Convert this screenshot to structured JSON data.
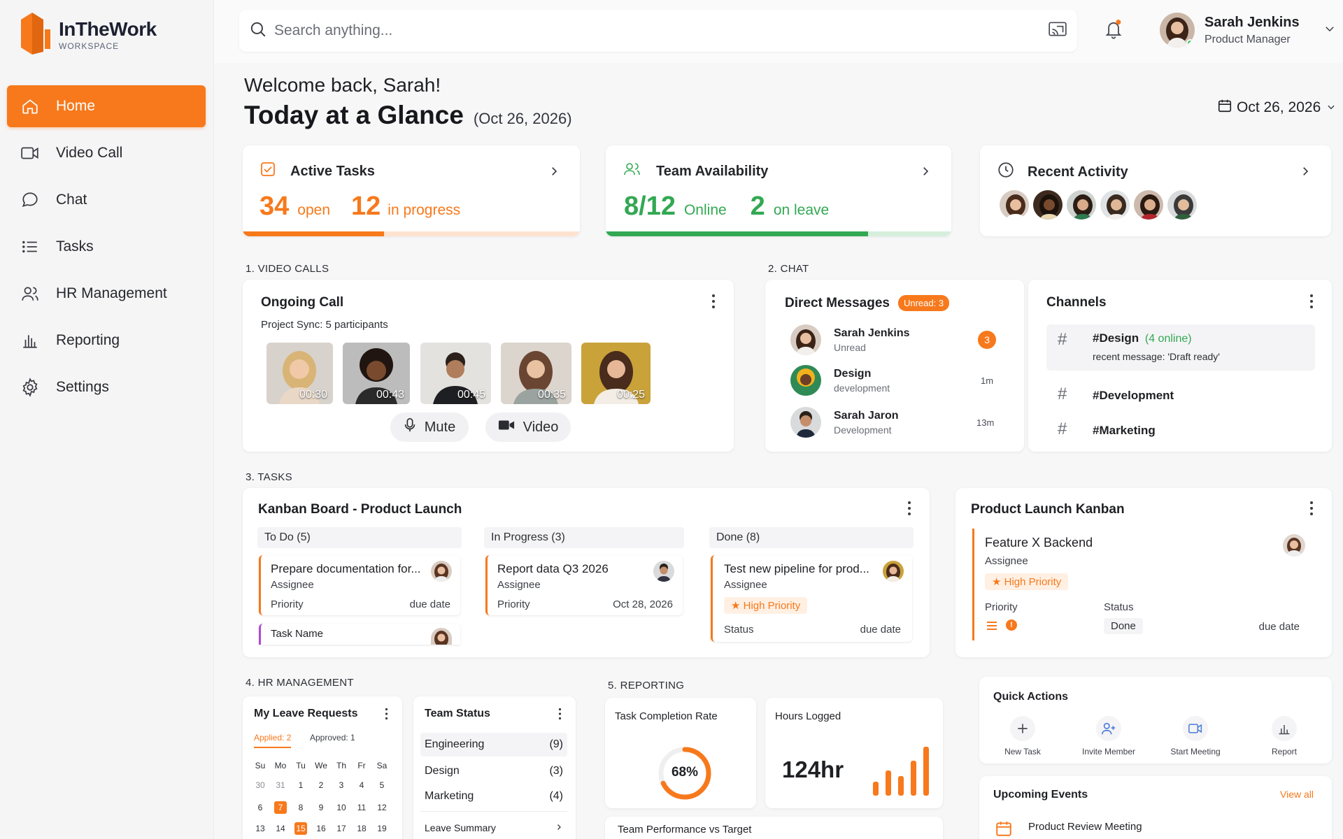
{
  "app": {
    "name": "InTheWork",
    "subtitle": "WORKSPACE"
  },
  "colors": {
    "accent": "#f7791c",
    "green": "#33a853",
    "text": "#1f2024"
  },
  "sidebar": {
    "items": [
      {
        "label": "Home",
        "icon": "home-icon",
        "active": true
      },
      {
        "label": "Video Call",
        "icon": "video-icon"
      },
      {
        "label": "Chat",
        "icon": "chat-icon"
      },
      {
        "label": "Tasks",
        "icon": "list-icon"
      },
      {
        "label": "HR Management",
        "icon": "people-icon"
      },
      {
        "label": "Reporting",
        "icon": "bar-chart-icon"
      },
      {
        "label": "Settings",
        "icon": "gear-icon"
      }
    ]
  },
  "topbar": {
    "search_placeholder": "Search anything...",
    "user_name": "Sarah Jenkins",
    "user_role": "Product Manager"
  },
  "header": {
    "greeting": "Welcome back, Sarah!",
    "title": "Today at a Glance",
    "title_date": "(Oct 26, 2026)",
    "date_picker": "Oct 26, 2026"
  },
  "kpi": {
    "tasks": {
      "title": "Active Tasks",
      "open": "34",
      "open_label": "open",
      "progress": "12",
      "progress_label": "in progress",
      "fill": 0.42
    },
    "team": {
      "title": "Team Availability",
      "online": "8/12",
      "online_label": "Online",
      "leave": "2",
      "leave_label": "on leave",
      "fill": 0.76
    },
    "activity": {
      "title": "Recent Activity"
    }
  },
  "video": {
    "section": "1. VIDEO CALLS",
    "title": "Ongoing Call",
    "subtitle": "Project Sync: 5 participants",
    "times": [
      "00:30",
      "00:43",
      "00:45",
      "00:35",
      "00:25"
    ],
    "mute": "Mute",
    "video": "Video"
  },
  "chat": {
    "section": "2. CHAT",
    "dm_title": "Direct Messages",
    "unread_badge": "Unread: 3",
    "dms": [
      {
        "name": "Sarah Jenkins",
        "sub": "Unread",
        "meta": "3"
      },
      {
        "name": "Design",
        "sub": "development",
        "meta": "1m"
      },
      {
        "name": "Sarah Jaron",
        "sub": "Development",
        "meta": "13m"
      }
    ],
    "channels_title": "Channels",
    "channels": [
      {
        "name": "#Design",
        "extra": "(4 online)",
        "msg": "recent message: 'Draft ready'"
      },
      {
        "name": "#Development"
      },
      {
        "name": "#Marketing"
      }
    ]
  },
  "tasks": {
    "section": "3. TASKS",
    "board_title": "Kanban Board - Product Launch",
    "columns": [
      "To Do (5)",
      "In Progress (3)",
      "Done (8)"
    ],
    "cards": [
      {
        "title": "Prepare documentation for...",
        "assignee": "Assignee",
        "priority": "Priority",
        "due": "due date"
      },
      {
        "title": "Report data Q3 2026",
        "assignee": "Assignee",
        "priority": "Priority",
        "due": "Oct 28, 2026"
      },
      {
        "title": "Test new pipeline for prod...",
        "assignee": "Assignee",
        "badge": "★ High Priority",
        "status": "Status",
        "due": "due date"
      }
    ],
    "task_name": "Task Name",
    "side_title": "Product Launch Kanban",
    "side_card": {
      "title": "Feature X Backend",
      "assignee": "Assignee",
      "badge": "★ High Priority",
      "priority": "Priority",
      "status": "Status",
      "status_value": "Done",
      "due": "due date"
    }
  },
  "hr": {
    "section": "4. HR MANAGEMENT",
    "leave_title": "My Leave Requests",
    "applied": "Applied: 2",
    "approved": "Approved: 1",
    "weekdays": [
      "Su",
      "Mo",
      "Tu",
      "We",
      "Th",
      "Fr",
      "Sa"
    ],
    "weeks": [
      [
        "30",
        "31",
        "1",
        "2",
        "3",
        "4",
        "5"
      ],
      [
        "6",
        "7",
        "8",
        "9",
        "10",
        "11",
        "12"
      ],
      [
        "13",
        "14",
        "15",
        "16",
        "17",
        "18",
        "19"
      ]
    ],
    "team_title": "Team Status",
    "teams": [
      {
        "name": "Engineering",
        "count": "(9)"
      },
      {
        "name": "Design",
        "count": "(3)"
      },
      {
        "name": "Marketing",
        "count": "(4)"
      }
    ],
    "leave_summary": "Leave Summary"
  },
  "reporting": {
    "section": "5. REPORTING",
    "completion_title": "Task Completion Rate",
    "completion_value": "68%",
    "completion_fraction": 0.68,
    "hours_title": "Hours Logged",
    "hours_value": "124hr",
    "perf_title": "Team Performance vs Target"
  },
  "quick": {
    "title": "Quick Actions",
    "actions": [
      {
        "label": "New Task",
        "icon": "plus-icon"
      },
      {
        "label": "Invite Member",
        "icon": "add-user-icon"
      },
      {
        "label": "Start Meeting",
        "icon": "video-icon"
      },
      {
        "label": "Report",
        "icon": "bar-chart-icon"
      }
    ]
  },
  "events": {
    "title": "Upcoming Events",
    "view_all": "View all",
    "first": "Product Review Meeting"
  }
}
